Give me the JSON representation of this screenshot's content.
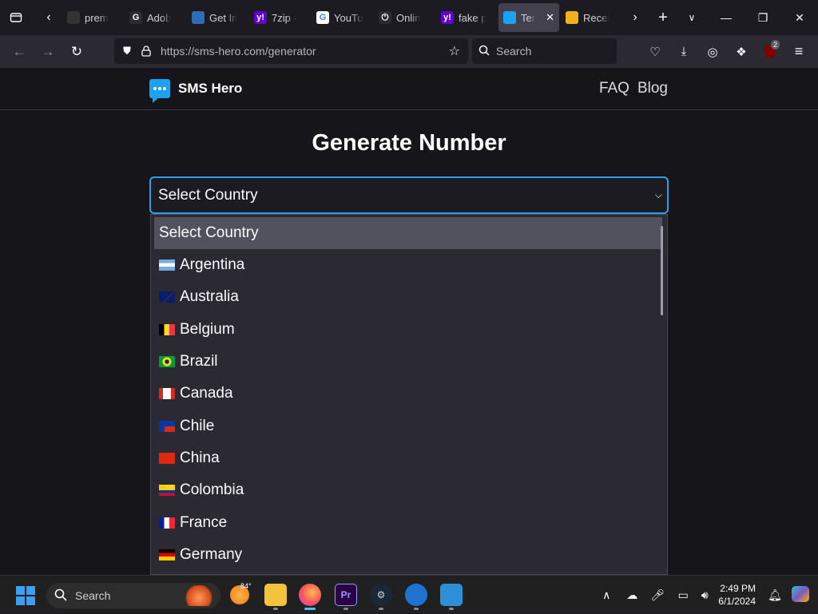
{
  "browser": {
    "tabs": [
      {
        "label": "prem",
        "favicon_color": "#333",
        "favicon_text": ""
      },
      {
        "label": "Adob",
        "favicon_color": "#2b2a33",
        "favicon_text": "G"
      },
      {
        "label": "Get In",
        "favicon_color": "#2d6db5",
        "favicon_text": ""
      },
      {
        "label": "7zip -",
        "favicon_color": "#6001d2",
        "favicon_text": "y!"
      },
      {
        "label": "YouTu",
        "favicon_color": "#ffffff",
        "favicon_text": "G"
      },
      {
        "label": "Onlin",
        "favicon_color": "#2b2a33",
        "favicon_text": "⏻"
      },
      {
        "label": "fake p",
        "favicon_color": "#6001d2",
        "favicon_text": "y!"
      },
      {
        "label": "Ter",
        "favicon_color": "#1fa1f2",
        "favicon_text": "",
        "active": true
      },
      {
        "label": "Recei",
        "favicon_color": "#f2b01f",
        "favicon_text": ""
      }
    ],
    "url": "https://sms-hero.com/generator",
    "search_placeholder": "Search",
    "extension_badge": "2"
  },
  "site": {
    "brand": "SMS Hero",
    "nav": {
      "faq": "FAQ",
      "blog": "Blog"
    },
    "title": "Generate Number",
    "select": {
      "value": "Select Country",
      "options": [
        {
          "label": "Select Country",
          "flag": null
        },
        {
          "label": "Argentina",
          "flag": "ar"
        },
        {
          "label": "Australia",
          "flag": "au"
        },
        {
          "label": "Belgium",
          "flag": "be"
        },
        {
          "label": "Brazil",
          "flag": "br"
        },
        {
          "label": "Canada",
          "flag": "ca"
        },
        {
          "label": "Chile",
          "flag": "cl"
        },
        {
          "label": "China",
          "flag": "cn"
        },
        {
          "label": "Colombia",
          "flag": "co"
        },
        {
          "label": "France",
          "flag": "fr"
        },
        {
          "label": "Germany",
          "flag": "de"
        }
      ]
    }
  },
  "taskbar": {
    "search_label": "Search",
    "weather_temp": "84°",
    "time": "2:49 PM",
    "date": "6/1/2024"
  },
  "colors": {
    "accent": "#2b9ee8",
    "brand_icon": "#1fa1f2"
  }
}
